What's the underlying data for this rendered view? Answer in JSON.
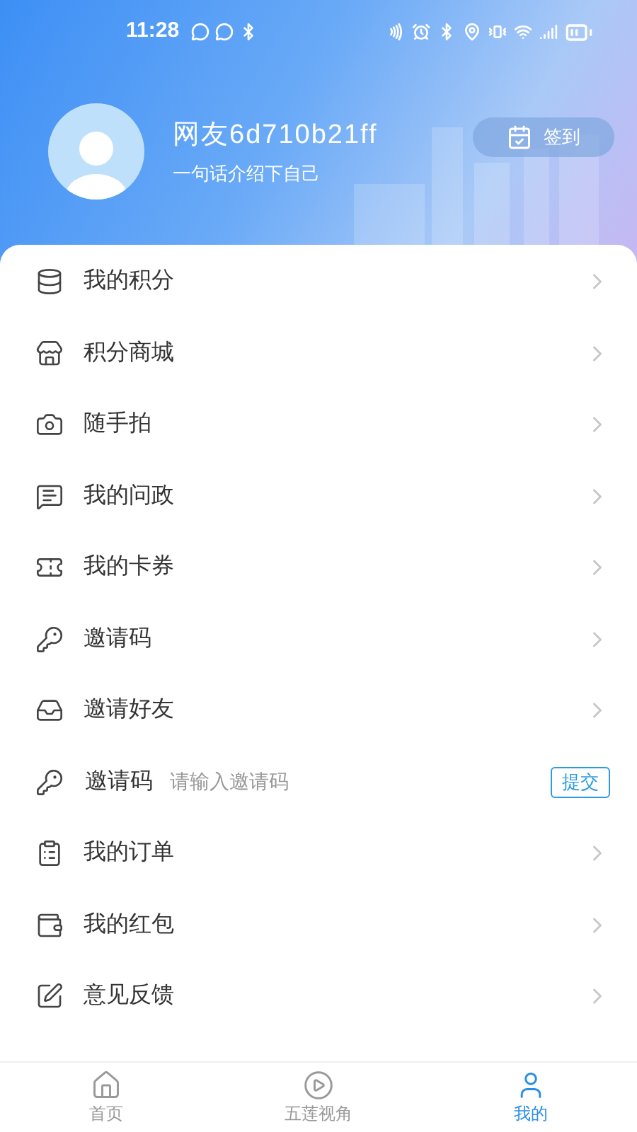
{
  "status_bar": {
    "time": "11:28"
  },
  "profile": {
    "name": "网友6d710b21ff",
    "bio": "一句话介绍下自己",
    "checkin": "签到"
  },
  "menu": [
    {
      "kind": "link",
      "label": "我的积分"
    },
    {
      "kind": "link",
      "label": "积分商城"
    },
    {
      "kind": "link",
      "label": "随手拍"
    },
    {
      "kind": "link",
      "label": "我的问政"
    },
    {
      "kind": "link",
      "label": "我的卡券"
    },
    {
      "kind": "link",
      "label": "邀请码"
    },
    {
      "kind": "link",
      "label": "邀请好友"
    },
    {
      "kind": "input",
      "label": "邀请码",
      "placeholder": "请输入邀请码",
      "button": "提交"
    },
    {
      "kind": "link",
      "label": "我的订单"
    },
    {
      "kind": "link",
      "label": "我的红包"
    },
    {
      "kind": "link",
      "label": "意见反馈"
    }
  ],
  "tabs": [
    {
      "label": "首页",
      "selected": false
    },
    {
      "label": "五莲视角",
      "selected": false
    },
    {
      "label": "我的",
      "selected": true
    }
  ]
}
